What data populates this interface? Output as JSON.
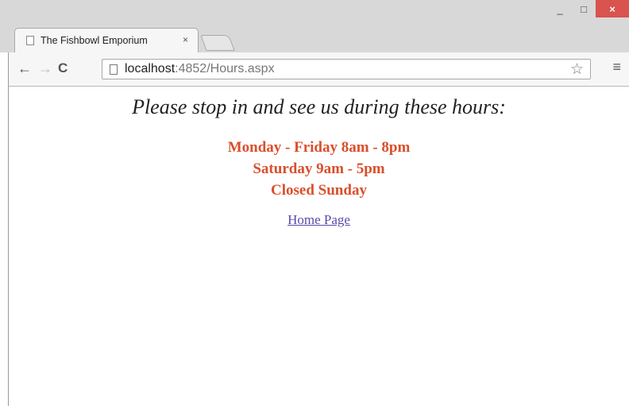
{
  "browser": {
    "tab": {
      "title": "The Fishbowl Emporium",
      "close_label": "×"
    },
    "window_controls": {
      "minimize": "_",
      "maximize": "□",
      "close": "×"
    },
    "nav": {
      "back": "←",
      "forward": "→",
      "reload": "C"
    },
    "address_bar": {
      "host": "localhost",
      "path": ":4852/Hours.aspx"
    },
    "bookmark_star": "☆",
    "menu": "≡"
  },
  "page": {
    "heading": "Please stop in and see us during these hours:",
    "hours": [
      "Monday - Friday 8am - 8pm",
      "Saturday 9am - 5pm",
      "Closed Sunday"
    ],
    "home_link": "Home Page",
    "hours_color": "#d94f2b",
    "link_color": "#5a4aa8"
  }
}
